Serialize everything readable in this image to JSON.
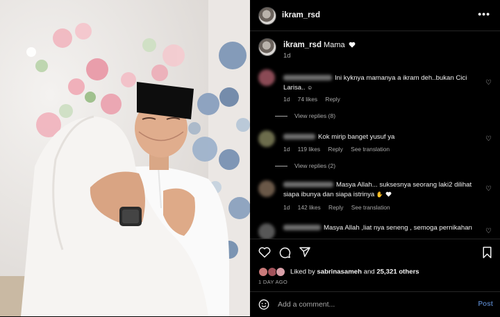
{
  "post": {
    "username": "ikram_rsd",
    "more_icon": "more-horizontal-icon",
    "caption_text": "Mama",
    "caption_time": "1d"
  },
  "comments": [
    {
      "text": "Ini kyknya mamanya a ikram deh..bukan Cici Larisa..",
      "time": "1d",
      "likes": "74 likes",
      "reply": "Reply",
      "view_replies": "View replies (8)"
    },
    {
      "text": "Kok mirip banget yusuf ya",
      "time": "1d",
      "likes": "119 likes",
      "reply": "Reply",
      "translation": "See translation",
      "view_replies": "View replies (2)"
    },
    {
      "text": "Masya Allah... suksesnya seorang laki2 dilihat siapa ibunya dan siapa istrinya",
      "time": "1d",
      "likes": "142 likes",
      "reply": "Reply",
      "translation": "See translation"
    },
    {
      "text": "Masya Allah ,liat nya seneng , semoga pernikahan"
    }
  ],
  "likes": {
    "prefix": "Liked by",
    "user": "sabrinasameh",
    "and": "and",
    "others": "25,321 others"
  },
  "posted_ago": "1 DAY AGO",
  "add_comment": {
    "placeholder": "Add a comment...",
    "post_label": "Post"
  },
  "colors": {
    "background": "#000000",
    "secondary_text": "#a8a8a8",
    "post_button": "#4a6fa5",
    "divider": "#262626"
  },
  "icons": [
    "heart-icon",
    "comment-icon",
    "share-icon",
    "bookmark-icon",
    "emoji-icon"
  ]
}
